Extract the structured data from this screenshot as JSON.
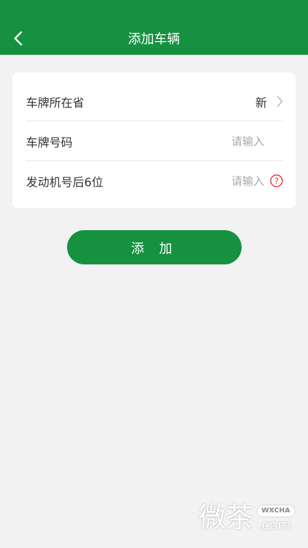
{
  "header": {
    "title": "添加车辆"
  },
  "form": {
    "province": {
      "label": "车牌所在省",
      "value": "新"
    },
    "plate": {
      "label": "车牌号码",
      "placeholder": "请输入"
    },
    "engine": {
      "label": "发动机号后6位",
      "placeholder": "请输入"
    }
  },
  "add_button": {
    "label": "添 加"
  },
  "watermark": {
    "text": "微茶",
    "badge": "WXCHA",
    "domain": ".com"
  },
  "colors": {
    "brand": "#16913f",
    "background": "#f2f2f2",
    "help": "#e53935"
  },
  "icons": {
    "back": "back-arrow-icon",
    "chevron": "chevron-right-icon",
    "help": "question-circle-icon"
  }
}
